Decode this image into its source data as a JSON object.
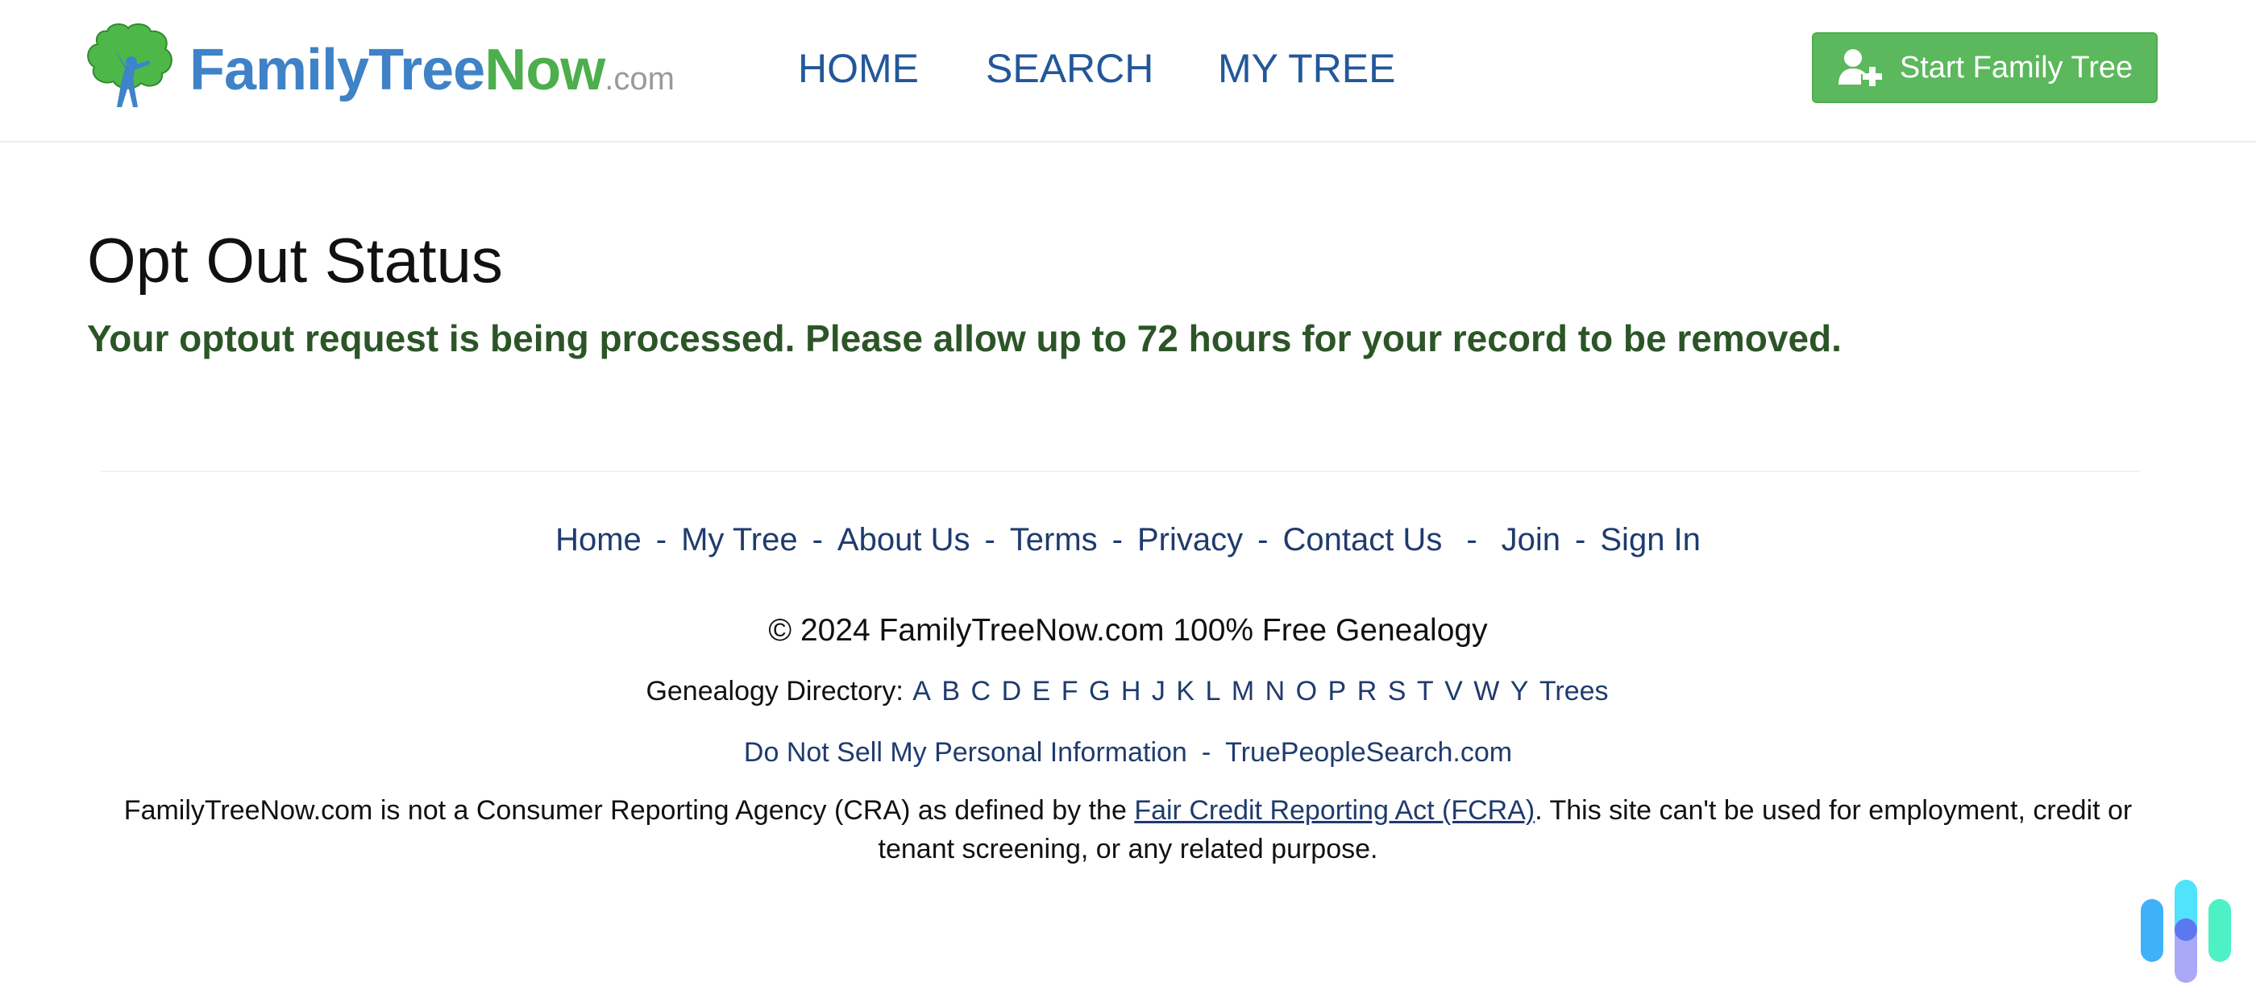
{
  "header": {
    "logo": {
      "part1": "FamilyTree",
      "part2": "Now",
      "part3": ".com",
      "colors": {
        "blue": "#3f82c7",
        "green": "#4cae4c",
        "gray": "#9a9a9a"
      }
    },
    "nav": [
      {
        "label": "HOME"
      },
      {
        "label": "SEARCH"
      },
      {
        "label": "MY TREE"
      }
    ],
    "cta": {
      "label": "Start Family Tree",
      "icon": "user-plus-icon",
      "color": "#5cb85c"
    }
  },
  "main": {
    "title": "Opt Out Status",
    "status_message": "Your optout request is being processed. Please allow up to 72 hours for your record to be removed.",
    "status_color": "#2c5527"
  },
  "footer": {
    "links": [
      {
        "label": "Home"
      },
      {
        "label": "My Tree"
      },
      {
        "label": "About Us"
      },
      {
        "label": "Terms"
      },
      {
        "label": "Privacy"
      },
      {
        "label": "Contact Us"
      },
      {
        "label": "Join"
      },
      {
        "label": "Sign In"
      }
    ],
    "separator": "-",
    "copyright": "© 2024 FamilyTreeNow.com 100% Free Genealogy",
    "directory": {
      "label": "Genealogy Directory:",
      "letters": [
        "A",
        "B",
        "C",
        "D",
        "E",
        "F",
        "G",
        "H",
        "J",
        "K",
        "L",
        "M",
        "N",
        "O",
        "P",
        "R",
        "S",
        "T",
        "V",
        "W",
        "Y"
      ],
      "trees_label": "Trees"
    },
    "legal_links": [
      {
        "label": "Do Not Sell My Personal Information"
      },
      {
        "label": "TruePeopleSearch.com"
      }
    ],
    "disclaimer": {
      "before": "FamilyTreeNow.com is not a Consumer Reporting Agency (CRA) as defined by the ",
      "link": "Fair Credit Reporting Act (FCRA)",
      "after": ". This site can't be used for employment, credit or tenant screening, or any related purpose."
    },
    "link_color": "#1f3b6e"
  },
  "watermark": {
    "icon": "brand-bars-icon"
  }
}
